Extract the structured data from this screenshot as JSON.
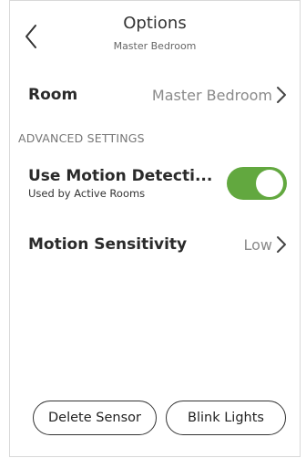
{
  "header": {
    "title": "Options",
    "subtitle": "Master Bedroom",
    "back_icon": "chevron-left-icon"
  },
  "room_row": {
    "label": "Room",
    "value": "Master Bedroom",
    "icon": "chevron-right-icon"
  },
  "advanced": {
    "section_title": "ADVANCED SETTINGS",
    "motion_detection": {
      "label": "Use Motion Detecti...",
      "sublabel": "Used by Active Rooms",
      "enabled": true,
      "toggle_color": "#62a83f"
    },
    "sensitivity": {
      "label": "Motion Sensitivity",
      "value": "Low",
      "icon": "chevron-right-icon"
    }
  },
  "actions": {
    "delete_label": "Delete Sensor",
    "blink_label": "Blink Lights"
  }
}
